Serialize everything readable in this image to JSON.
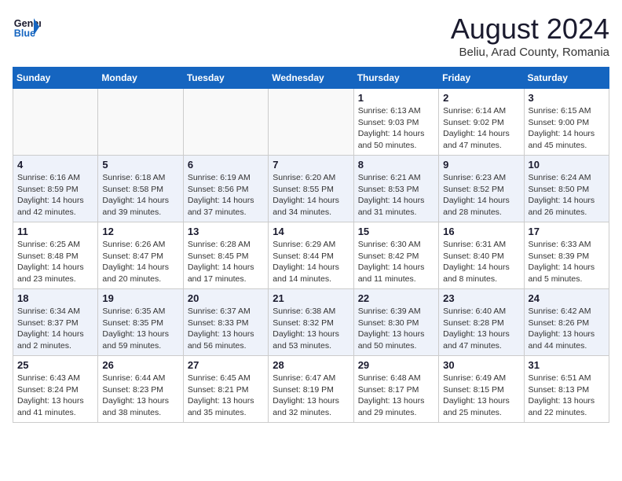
{
  "header": {
    "logo_line1": "General",
    "logo_line2": "Blue",
    "month_year": "August 2024",
    "location": "Beliu, Arad County, Romania"
  },
  "weekdays": [
    "Sunday",
    "Monday",
    "Tuesday",
    "Wednesday",
    "Thursday",
    "Friday",
    "Saturday"
  ],
  "weeks": [
    [
      {
        "day": "",
        "info": ""
      },
      {
        "day": "",
        "info": ""
      },
      {
        "day": "",
        "info": ""
      },
      {
        "day": "",
        "info": ""
      },
      {
        "day": "1",
        "info": "Sunrise: 6:13 AM\nSunset: 9:03 PM\nDaylight: 14 hours and 50 minutes."
      },
      {
        "day": "2",
        "info": "Sunrise: 6:14 AM\nSunset: 9:02 PM\nDaylight: 14 hours and 47 minutes."
      },
      {
        "day": "3",
        "info": "Sunrise: 6:15 AM\nSunset: 9:00 PM\nDaylight: 14 hours and 45 minutes."
      }
    ],
    [
      {
        "day": "4",
        "info": "Sunrise: 6:16 AM\nSunset: 8:59 PM\nDaylight: 14 hours and 42 minutes."
      },
      {
        "day": "5",
        "info": "Sunrise: 6:18 AM\nSunset: 8:58 PM\nDaylight: 14 hours and 39 minutes."
      },
      {
        "day": "6",
        "info": "Sunrise: 6:19 AM\nSunset: 8:56 PM\nDaylight: 14 hours and 37 minutes."
      },
      {
        "day": "7",
        "info": "Sunrise: 6:20 AM\nSunset: 8:55 PM\nDaylight: 14 hours and 34 minutes."
      },
      {
        "day": "8",
        "info": "Sunrise: 6:21 AM\nSunset: 8:53 PM\nDaylight: 14 hours and 31 minutes."
      },
      {
        "day": "9",
        "info": "Sunrise: 6:23 AM\nSunset: 8:52 PM\nDaylight: 14 hours and 28 minutes."
      },
      {
        "day": "10",
        "info": "Sunrise: 6:24 AM\nSunset: 8:50 PM\nDaylight: 14 hours and 26 minutes."
      }
    ],
    [
      {
        "day": "11",
        "info": "Sunrise: 6:25 AM\nSunset: 8:48 PM\nDaylight: 14 hours and 23 minutes."
      },
      {
        "day": "12",
        "info": "Sunrise: 6:26 AM\nSunset: 8:47 PM\nDaylight: 14 hours and 20 minutes."
      },
      {
        "day": "13",
        "info": "Sunrise: 6:28 AM\nSunset: 8:45 PM\nDaylight: 14 hours and 17 minutes."
      },
      {
        "day": "14",
        "info": "Sunrise: 6:29 AM\nSunset: 8:44 PM\nDaylight: 14 hours and 14 minutes."
      },
      {
        "day": "15",
        "info": "Sunrise: 6:30 AM\nSunset: 8:42 PM\nDaylight: 14 hours and 11 minutes."
      },
      {
        "day": "16",
        "info": "Sunrise: 6:31 AM\nSunset: 8:40 PM\nDaylight: 14 hours and 8 minutes."
      },
      {
        "day": "17",
        "info": "Sunrise: 6:33 AM\nSunset: 8:39 PM\nDaylight: 14 hours and 5 minutes."
      }
    ],
    [
      {
        "day": "18",
        "info": "Sunrise: 6:34 AM\nSunset: 8:37 PM\nDaylight: 14 hours and 2 minutes."
      },
      {
        "day": "19",
        "info": "Sunrise: 6:35 AM\nSunset: 8:35 PM\nDaylight: 13 hours and 59 minutes."
      },
      {
        "day": "20",
        "info": "Sunrise: 6:37 AM\nSunset: 8:33 PM\nDaylight: 13 hours and 56 minutes."
      },
      {
        "day": "21",
        "info": "Sunrise: 6:38 AM\nSunset: 8:32 PM\nDaylight: 13 hours and 53 minutes."
      },
      {
        "day": "22",
        "info": "Sunrise: 6:39 AM\nSunset: 8:30 PM\nDaylight: 13 hours and 50 minutes."
      },
      {
        "day": "23",
        "info": "Sunrise: 6:40 AM\nSunset: 8:28 PM\nDaylight: 13 hours and 47 minutes."
      },
      {
        "day": "24",
        "info": "Sunrise: 6:42 AM\nSunset: 8:26 PM\nDaylight: 13 hours and 44 minutes."
      }
    ],
    [
      {
        "day": "25",
        "info": "Sunrise: 6:43 AM\nSunset: 8:24 PM\nDaylight: 13 hours and 41 minutes."
      },
      {
        "day": "26",
        "info": "Sunrise: 6:44 AM\nSunset: 8:23 PM\nDaylight: 13 hours and 38 minutes."
      },
      {
        "day": "27",
        "info": "Sunrise: 6:45 AM\nSunset: 8:21 PM\nDaylight: 13 hours and 35 minutes."
      },
      {
        "day": "28",
        "info": "Sunrise: 6:47 AM\nSunset: 8:19 PM\nDaylight: 13 hours and 32 minutes."
      },
      {
        "day": "29",
        "info": "Sunrise: 6:48 AM\nSunset: 8:17 PM\nDaylight: 13 hours and 29 minutes."
      },
      {
        "day": "30",
        "info": "Sunrise: 6:49 AM\nSunset: 8:15 PM\nDaylight: 13 hours and 25 minutes."
      },
      {
        "day": "31",
        "info": "Sunrise: 6:51 AM\nSunset: 8:13 PM\nDaylight: 13 hours and 22 minutes."
      }
    ]
  ]
}
